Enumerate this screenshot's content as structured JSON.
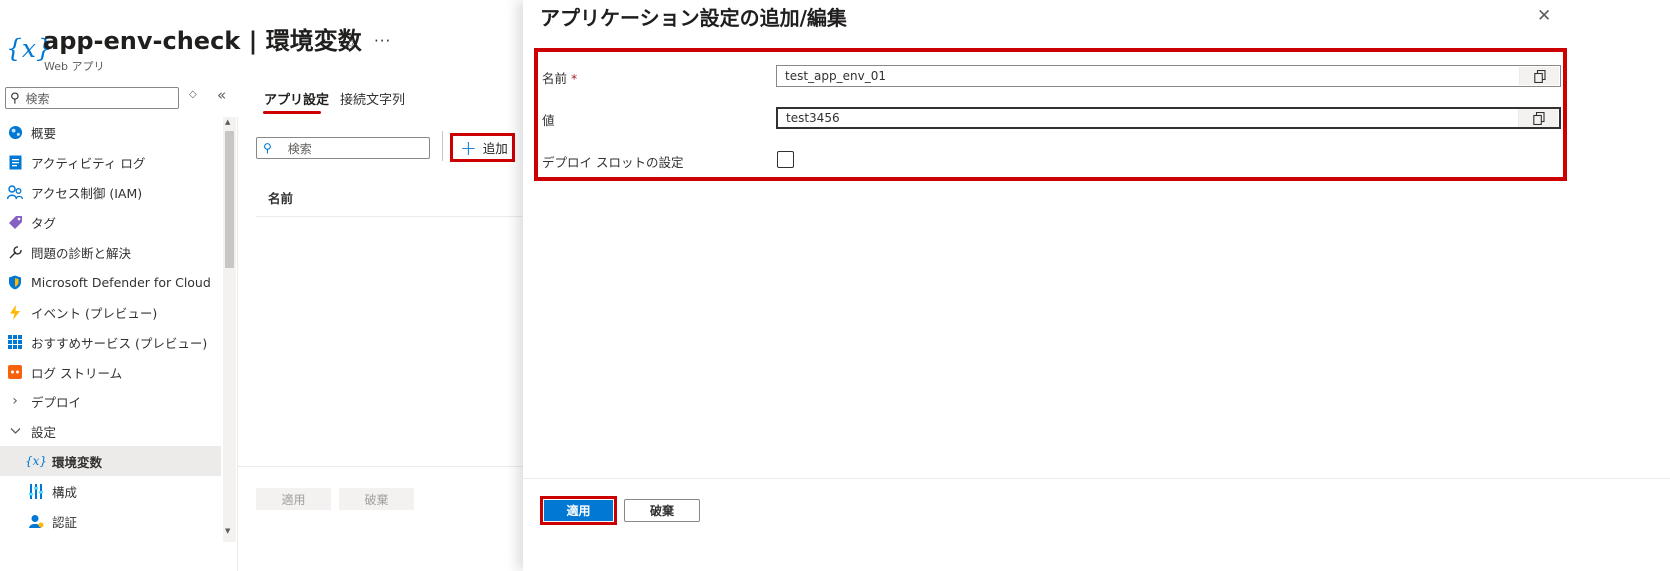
{
  "header": {
    "title": "app-env-check | 環境変数",
    "subtitle": "Web アプリ",
    "resource_icon": "{x}",
    "favorite_icon": "star-icon",
    "more_icon": "ellipsis-icon"
  },
  "sidebar": {
    "search_placeholder": "検索",
    "items": [
      {
        "label": "概要",
        "icon": "overview-globe-icon"
      },
      {
        "label": "アクティビティ ログ",
        "icon": "activity-log-icon"
      },
      {
        "label": "アクセス制御 (IAM)",
        "icon": "iam-people-icon"
      },
      {
        "label": "タグ",
        "icon": "tag-icon"
      },
      {
        "label": "問題の診断と解決",
        "icon": "wrench-icon"
      },
      {
        "label": "Microsoft Defender for Cloud",
        "icon": "shield-icon"
      },
      {
        "label": "イベント (プレビュー)",
        "icon": "lightning-icon"
      },
      {
        "label": "おすすめサービス (プレビュー)",
        "icon": "grid-icon"
      },
      {
        "label": "ログ ストリーム",
        "icon": "log-stream-icon"
      },
      {
        "label": "デプロイ",
        "icon": "chevron-right-icon"
      },
      {
        "label": "設定",
        "icon": "chevron-down-icon"
      },
      {
        "label": "環境変数",
        "icon": "env-variable-icon"
      },
      {
        "label": "構成",
        "icon": "configuration-icon"
      },
      {
        "label": "認証",
        "icon": "authentication-icon"
      }
    ]
  },
  "main": {
    "tabs": [
      {
        "label": "アプリ設定",
        "selected": true
      },
      {
        "label": "接続文字列",
        "selected": false
      }
    ],
    "search_placeholder": "検索",
    "add_label": "追加",
    "column_name": "名前",
    "apply_label": "適用",
    "discard_label": "破棄"
  },
  "panel": {
    "title": "アプリケーション設定の追加/編集",
    "name_label": "名前",
    "required_mark": "*",
    "name_value": "test_app_env_01",
    "value_label": "値",
    "value_value": "test3456",
    "slot_label": "デプロイ スロットの設定",
    "slot_checked": false,
    "apply_label": "適用",
    "discard_label": "破棄"
  },
  "colors": {
    "accent": "#0078d4",
    "highlight": "#cc0000"
  }
}
